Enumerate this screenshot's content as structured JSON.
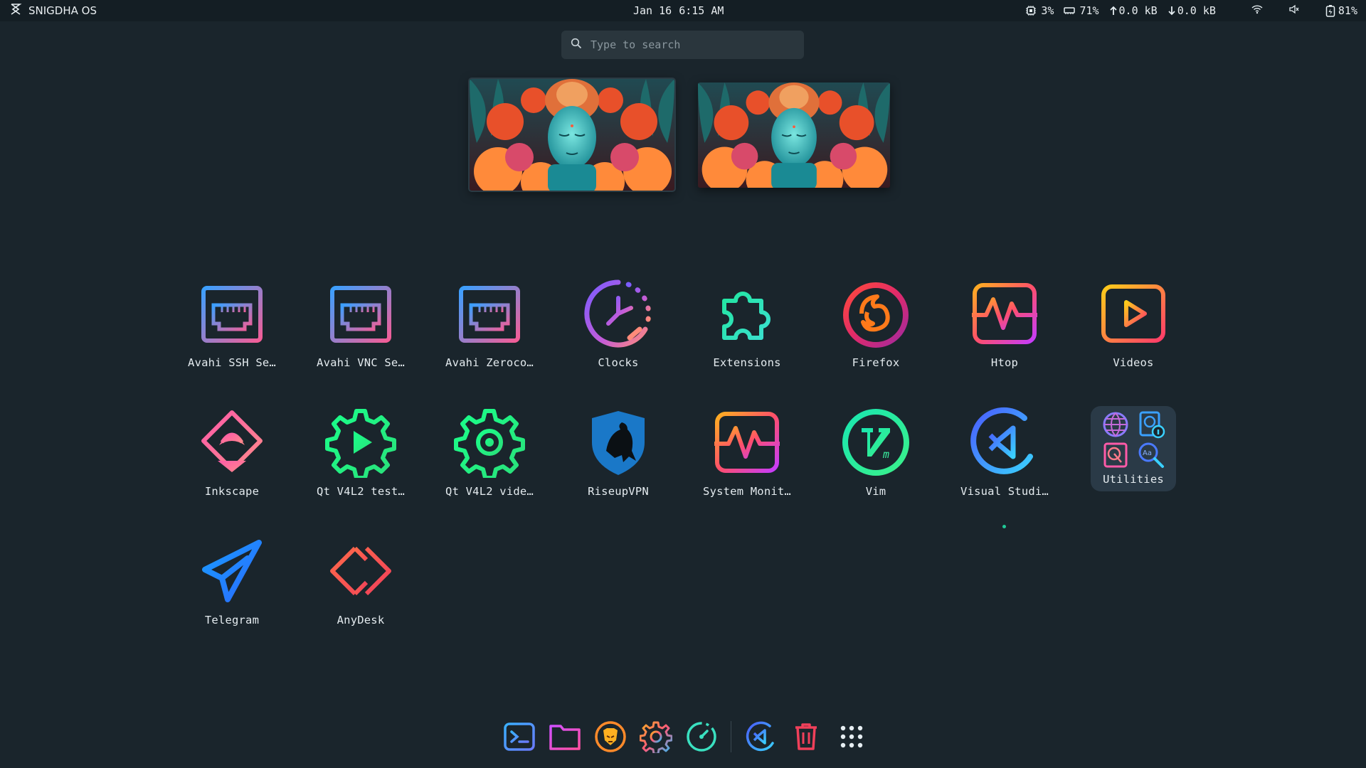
{
  "topbar": {
    "os_name": "SNIGDHA OS",
    "date": "Jan 16",
    "time": "6:15 AM",
    "cpu": "3%",
    "ram": "71%",
    "upload": "0.0 kB",
    "download": "0.0 kB",
    "battery": "81%",
    "icons": [
      "snigdha-logo-icon",
      "cpu-icon",
      "ram-icon",
      "upload-arrow-icon",
      "download-arrow-icon",
      "wifi-icon",
      "volume-icon",
      "battery-icon"
    ]
  },
  "search": {
    "placeholder": "Type to search"
  },
  "workspaces": [
    "workspace-1",
    "workspace-2"
  ],
  "apps": {
    "row1": [
      "Avahi SSH Se…",
      "Avahi VNC Se…",
      "Avahi Zeroco…",
      "Clocks",
      "Extensions",
      "Firefox",
      "Htop",
      "Videos"
    ],
    "row2": [
      "Inkscape",
      "Qt V4L2 test…",
      "Qt V4L2 vide…",
      "RiseupVPN",
      "System Monit…",
      "Vim",
      "Visual Studi…",
      "Utilities"
    ],
    "row3": [
      "Telegram",
      "AnyDesk"
    ]
  },
  "dock": [
    "terminal-icon",
    "files-icon",
    "brave-icon",
    "settings-icon",
    "system-monitor-icon",
    "vscode-icon",
    "trash-icon",
    "app-grid-icon"
  ],
  "colors": {
    "background": "#1a252c",
    "topbar": "#141e24",
    "accent_pink": "#f0508c",
    "accent_teal": "#20e0a0",
    "accent_blue": "#3a8cff",
    "accent_orange": "#ff8a2a"
  }
}
